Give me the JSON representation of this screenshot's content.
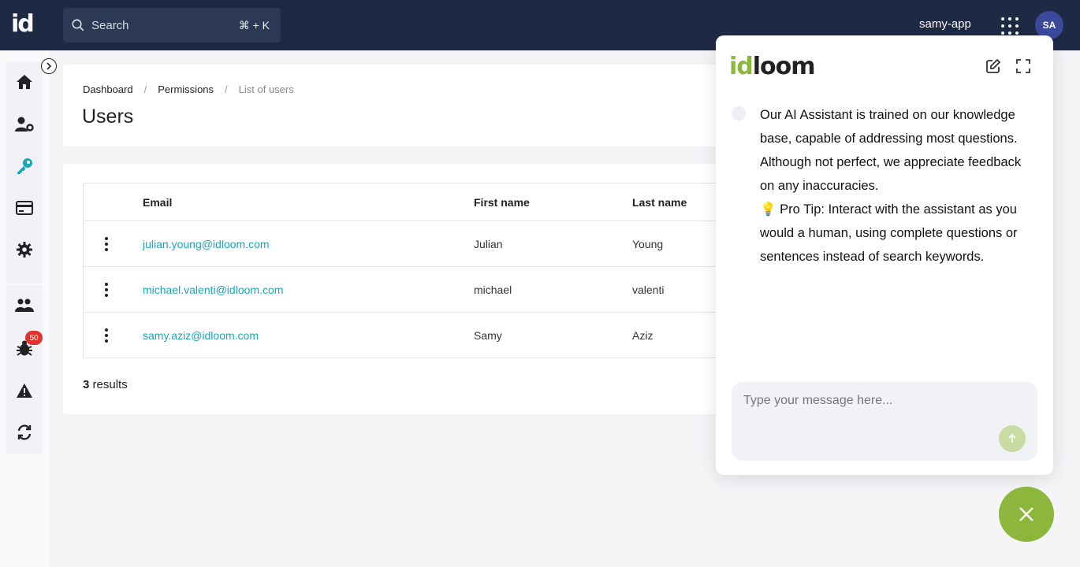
{
  "topbar": {
    "logo": "id",
    "search_label": "Search",
    "search_shortcut": "⌘ + K",
    "app_name": "samy-app",
    "avatar_initials": "SA"
  },
  "sidebar": {
    "items": [
      {
        "icon": "home-icon"
      },
      {
        "icon": "user-settings-icon"
      },
      {
        "icon": "key-icon",
        "active": true
      },
      {
        "icon": "credit-card-icon"
      },
      {
        "icon": "gear-icon"
      },
      {
        "icon": "users-group-icon"
      },
      {
        "icon": "bug-icon",
        "badge": "50"
      },
      {
        "icon": "warning-icon"
      },
      {
        "icon": "sync-icon"
      }
    ],
    "accent": "#1aa6b7"
  },
  "breadcrumb": {
    "items": [
      "Dashboard",
      "Permissions",
      "List of users"
    ]
  },
  "page": {
    "title": "Users"
  },
  "table": {
    "columns": [
      "Email",
      "First name",
      "Last name"
    ],
    "rows": [
      {
        "email": "julian.young@idloom.com",
        "first": "Julian",
        "last": "Young"
      },
      {
        "email": "michael.valenti@idloom.com",
        "first": "michael",
        "last": "valenti"
      },
      {
        "email": "samy.aziz@idloom.com",
        "first": "Samy",
        "last": "Aziz"
      }
    ],
    "results_count": "3",
    "results_label": " results"
  },
  "chat": {
    "logo_id": "id",
    "logo_loom": "loom",
    "message_lines": [
      "Our AI Assistant is trained on our knowledge base, capable of addressing most questions. Although not perfect, we appreciate feedback on any inaccuracies.",
      "💡 Pro Tip: Interact with the assistant as you would a human, using complete questions or sentences instead of search keywords."
    ],
    "input_placeholder": "Type your message here...",
    "brand_color": "#8cb63c"
  }
}
